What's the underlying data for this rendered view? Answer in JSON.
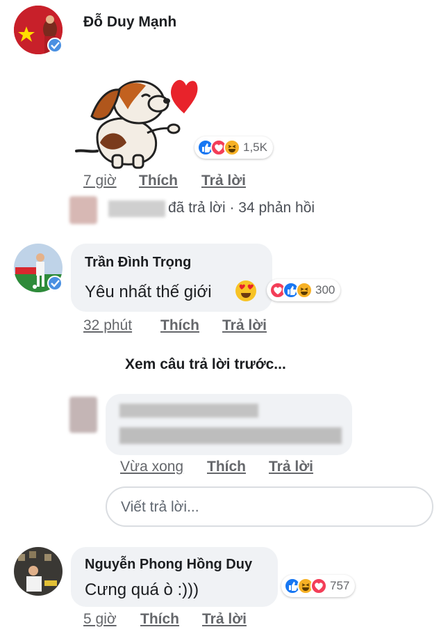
{
  "comments": [
    {
      "author": "Đỗ Duy Mạnh",
      "sticker": "dog-heart-sticker",
      "reactions": {
        "icons": [
          "like",
          "love",
          "haha"
        ],
        "count": "1,5K"
      },
      "actions": {
        "time": "7 giờ",
        "like": "Thích",
        "reply": "Trả lời"
      },
      "reply_summary": {
        "text": "đã trả lời · 34 phản hồi"
      }
    },
    {
      "author": "Trần Đình Trọng",
      "text": "Yêu nhất thế giới",
      "emoji": "heart-eyes-emoji",
      "reactions": {
        "icons": [
          "love",
          "like",
          "haha"
        ],
        "count": "300"
      },
      "actions": {
        "time": "32 phút",
        "like": "Thích",
        "reply": "Trả lời"
      }
    },
    {
      "author": "Nguyễn Phong Hồng Duy",
      "text": "Cưng quá ò :)))",
      "reactions": {
        "icons": [
          "like",
          "haha",
          "love"
        ],
        "count": "757"
      },
      "actions": {
        "time": "5 giờ",
        "like": "Thích",
        "reply": "Trả lời"
      }
    }
  ],
  "view_previous": "Xem câu trả lời trước...",
  "blurred_reply": {
    "actions": {
      "time": "Vừa xong",
      "like": "Thích",
      "reply": "Trả lời"
    }
  },
  "reply_input": {
    "placeholder": "Viết trả lời..."
  },
  "colors": {
    "like": "#1877f2",
    "love": "#f33e58",
    "haha": "#f7b125",
    "bubble": "#f0f2f5",
    "meta": "#65676b"
  }
}
